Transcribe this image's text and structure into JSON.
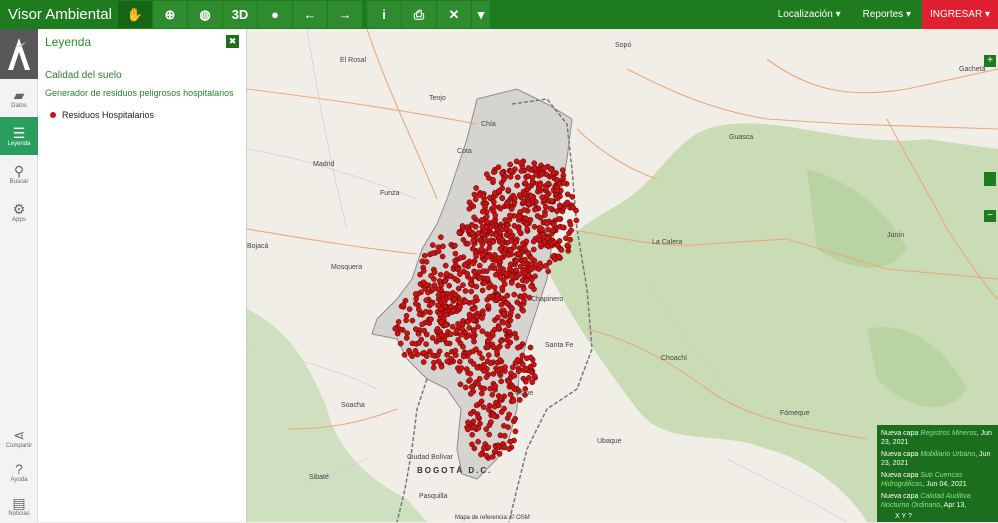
{
  "header": {
    "title": "Visor Ambiental",
    "tools": [
      {
        "name": "pan-hand-icon",
        "glyph": "✋",
        "active": true
      },
      {
        "name": "zoom-icon",
        "glyph": "⊕",
        "active": false
      },
      {
        "name": "globe-icon",
        "glyph": "◍",
        "active": false
      },
      {
        "name": "3d-button",
        "glyph": "3D",
        "active": false
      },
      {
        "name": "info-circle-icon",
        "glyph": "●",
        "active": false
      },
      {
        "name": "arrow-left-icon",
        "glyph": "←",
        "active": false
      },
      {
        "name": "arrow-right-icon",
        "glyph": "→",
        "active": false
      }
    ],
    "tools2": [
      {
        "name": "info-icon",
        "glyph": "i"
      },
      {
        "name": "print-icon",
        "glyph": "⎙"
      },
      {
        "name": "tools-icon",
        "glyph": "✕"
      },
      {
        "name": "caret-down-icon",
        "glyph": "▾"
      }
    ],
    "nav": [
      {
        "label": "Localización ▾"
      },
      {
        "label": "Reportes ▾"
      }
    ],
    "login": "INGRESAR ▾"
  },
  "rail": {
    "items": [
      {
        "label": "Datos",
        "icon": "layers-icon",
        "glyph": "▰",
        "active": false
      },
      {
        "label": "Leyenda",
        "icon": "menu-icon",
        "glyph": "☰",
        "active": true
      },
      {
        "label": "Buscar",
        "icon": "binoculars-icon",
        "glyph": "⚲",
        "active": false
      },
      {
        "label": "Apps",
        "icon": "gear-icon",
        "glyph": "⚙",
        "active": false
      }
    ],
    "bottom": [
      {
        "label": "Compartir",
        "icon": "share-icon",
        "glyph": "⋖"
      },
      {
        "label": "Ayuda",
        "icon": "help-icon",
        "glyph": "?"
      },
      {
        "label": "Noticias",
        "icon": "news-icon",
        "glyph": "▤"
      }
    ]
  },
  "legend": {
    "title": "Leyenda",
    "close": "✖",
    "layer_title": "Calidad del suelo",
    "layer_subtitle": "Generador de residuos peligrosos hospitalarios",
    "entry_label": "Residuos Hospitalarios",
    "entry_color": "#c81414"
  },
  "map": {
    "places": [
      {
        "name": "El Rosal"
      },
      {
        "name": "Tenjo"
      },
      {
        "name": "Sopó"
      },
      {
        "name": "Madrid"
      },
      {
        "name": "Funza"
      },
      {
        "name": "Mosquera"
      },
      {
        "name": "Cota"
      },
      {
        "name": "Chía"
      },
      {
        "name": "Guasca"
      },
      {
        "name": "La Calera"
      },
      {
        "name": "Junín"
      },
      {
        "name": "Choachí"
      },
      {
        "name": "Fómeque"
      },
      {
        "name": "Ubaque"
      },
      {
        "name": "Soacha"
      },
      {
        "name": "Sibaté"
      },
      {
        "name": "Ciudad Bolívar"
      },
      {
        "name": "Pasquilla"
      },
      {
        "name": "BOGOTÁ D.C."
      },
      {
        "name": "Gachetá"
      },
      {
        "name": "Bojacá"
      },
      {
        "name": "Santa Fe"
      },
      {
        "name": "Chapinero"
      },
      {
        "name": "Usme"
      }
    ],
    "zoom_in": "+",
    "zoom_out": "−",
    "attribution": "Mapa de referencia: © OSM"
  },
  "news": {
    "items": [
      {
        "prefix": "Nueva capa ",
        "layer": "Registros Mineros",
        "date": ", Jun 23, 2021"
      },
      {
        "prefix": "Nueva capa ",
        "layer": "Mobiliario Urbano",
        "date": ", Jun 23, 2021"
      },
      {
        "prefix": "Nueva capa ",
        "layer": "Sub Cuencas Hidrográficas",
        "date": ", Jun 04, 2021"
      },
      {
        "prefix": "Nueva capa ",
        "layer": "Calidad Auditiva Nocturno Ordinario",
        "date": ", Apr 13,"
      }
    ],
    "footer": "X Y ?"
  },
  "colors": {
    "header": "#1e7b1e",
    "accent": "#2b9e5f",
    "login": "#e02030",
    "points": "#c81414"
  }
}
